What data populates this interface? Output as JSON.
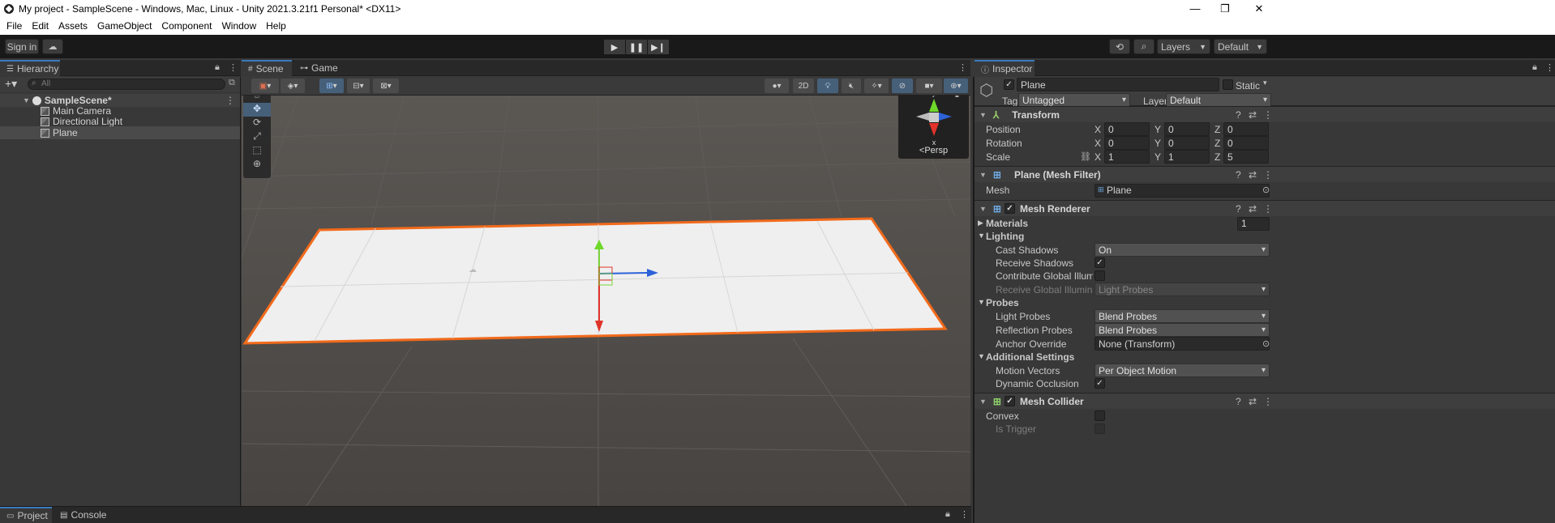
{
  "window": {
    "title": "My project - SampleScene - Windows, Mac, Linux - Unity 2021.3.21f1 Personal* <DX11>",
    "min": "—",
    "max": "❐",
    "close": "✕"
  },
  "menu": [
    "File",
    "Edit",
    "Assets",
    "GameObject",
    "Component",
    "Window",
    "Help"
  ],
  "toolbar": {
    "sign_in": "Sign in",
    "layers": "Layers",
    "layout": "Default"
  },
  "hierarchy": {
    "tab": "Hierarchy",
    "search_placeholder": "All",
    "scene_name": "SampleScene*",
    "items": [
      "Main Camera",
      "Directional Light",
      "Plane"
    ]
  },
  "scene": {
    "tabs": [
      "Scene",
      "Game"
    ],
    "mode_2d": "2D",
    "gizmo_label": "Persp",
    "axes": {
      "x": "x",
      "y": "y"
    }
  },
  "bottom": {
    "tabs": [
      "Project",
      "Console"
    ]
  },
  "inspector": {
    "tab": "Inspector",
    "object_name": "Plane",
    "static_label": "Static",
    "tag_label": "Tag",
    "tag_value": "Untagged",
    "layer_label": "Layer",
    "layer_value": "Default",
    "transform": {
      "title": "Transform",
      "position": {
        "label": "Position",
        "x": "0",
        "y": "0",
        "z": "0"
      },
      "rotation": {
        "label": "Rotation",
        "x": "0",
        "y": "0",
        "z": "0"
      },
      "scale": {
        "label": "Scale",
        "x": "1",
        "y": "1",
        "z": "5"
      },
      "axis_x": "X",
      "axis_y": "Y",
      "axis_z": "Z"
    },
    "mesh_filter": {
      "title": "Plane (Mesh Filter)",
      "mesh_label": "Mesh",
      "mesh_value": "Plane"
    },
    "mesh_renderer": {
      "title": "Mesh Renderer",
      "materials_label": "Materials",
      "materials_count": "1",
      "lighting": "Lighting",
      "cast_shadows_label": "Cast Shadows",
      "cast_shadows_value": "On",
      "receive_shadows_label": "Receive Shadows",
      "contribute_gi_label": "Contribute Global Illuminat",
      "receive_gi_label": "Receive Global Illuminatio",
      "receive_gi_value": "Light Probes",
      "probes": "Probes",
      "light_probes_label": "Light Probes",
      "light_probes_value": "Blend Probes",
      "reflection_probes_label": "Reflection Probes",
      "reflection_probes_value": "Blend Probes",
      "anchor_override_label": "Anchor Override",
      "anchor_override_value": "None (Transform)",
      "additional": "Additional Settings",
      "motion_vectors_label": "Motion Vectors",
      "motion_vectors_value": "Per Object Motion",
      "dynamic_occlusion_label": "Dynamic Occlusion"
    },
    "mesh_collider": {
      "title": "Mesh Collider",
      "convex_label": "Convex",
      "is_trigger_label": "Is Trigger"
    }
  },
  "colors": {
    "selection_outline": "#f26a1b",
    "plane": "#efefef",
    "viewport_bg": "#4d4a48",
    "accent": "#3a79bb"
  }
}
